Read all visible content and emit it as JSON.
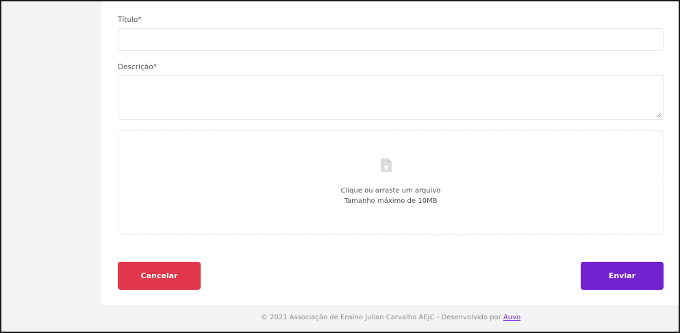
{
  "form": {
    "title_label": "Título*",
    "title_value": "",
    "description_label": "Descrição*",
    "description_value": "",
    "dropzone": {
      "icon": "file-upload-icon",
      "line1": "Clique ou arraste um arquivo",
      "line2": "Tamanho máximo de 10MB"
    },
    "cancel_label": "Cancelar",
    "submit_label": "Enviar"
  },
  "footer": {
    "text": "© 2021 Associação de Ensino Julian Carvalho AEJC - Desenvolvido por",
    "link_label": "Auvo"
  },
  "colors": {
    "background": "#f3f3f3",
    "card": "#ffffff",
    "cancel": "#e0374a",
    "submit": "#7421cf",
    "label": "#555a63",
    "footer_text": "#8a8e95"
  }
}
